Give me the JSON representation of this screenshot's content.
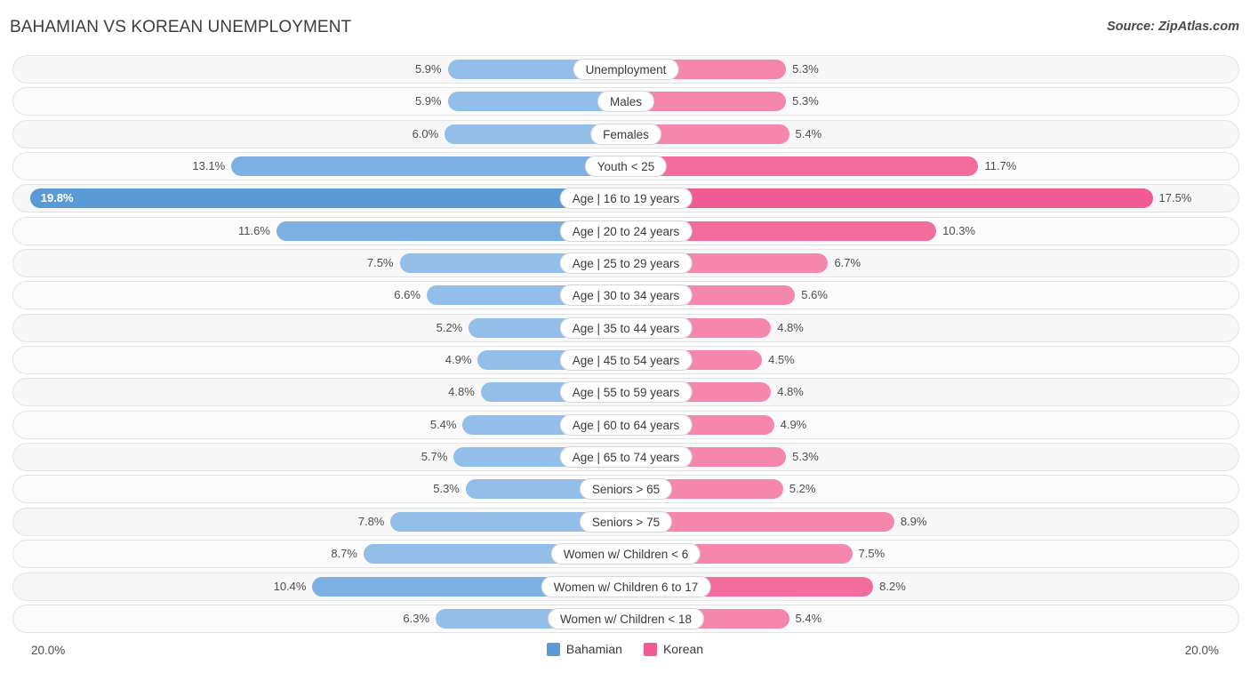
{
  "header": {
    "title": "BAHAMIAN VS KOREAN UNEMPLOYMENT",
    "source": "Source: ZipAtlas.com"
  },
  "axis": {
    "left_max_label": "20.0%",
    "right_max_label": "20.0%"
  },
  "legend": {
    "items": [
      {
        "label": "Bahamian",
        "color": "#5b9bd5"
      },
      {
        "label": "Korean",
        "color": "#ef5b92"
      }
    ]
  },
  "chart_data": {
    "type": "bar",
    "title": "BAHAMIAN VS KOREAN UNEMPLOYMENT",
    "orientation": "horizontal-diverging",
    "xlabel": "",
    "ylabel": "",
    "xlim": [
      0,
      20
    ],
    "axis_max": 20.0,
    "grid": false,
    "legend_position": "bottom-center",
    "categories": [
      "Unemployment",
      "Males",
      "Females",
      "Youth < 25",
      "Age | 16 to 19 years",
      "Age | 20 to 24 years",
      "Age | 25 to 29 years",
      "Age | 30 to 34 years",
      "Age | 35 to 44 years",
      "Age | 45 to 54 years",
      "Age | 55 to 59 years",
      "Age | 60 to 64 years",
      "Age | 65 to 74 years",
      "Seniors > 65",
      "Seniors > 75",
      "Women w/ Children < 6",
      "Women w/ Children 6 to 17",
      "Women w/ Children < 18"
    ],
    "series": [
      {
        "name": "Bahamian",
        "color": "#5b9bd5",
        "values": [
          5.9,
          5.9,
          6.0,
          13.1,
          19.8,
          11.6,
          7.5,
          6.6,
          5.2,
          4.9,
          4.8,
          5.4,
          5.7,
          5.3,
          7.8,
          8.7,
          10.4,
          6.3
        ],
        "labels": [
          "5.9%",
          "5.9%",
          "6.0%",
          "13.1%",
          "19.8%",
          "11.6%",
          "7.5%",
          "6.6%",
          "5.2%",
          "4.9%",
          "4.8%",
          "5.4%",
          "5.7%",
          "5.3%",
          "7.8%",
          "8.7%",
          "10.4%",
          "6.3%"
        ]
      },
      {
        "name": "Korean",
        "color": "#ef5b92",
        "values": [
          5.3,
          5.3,
          5.4,
          11.7,
          17.5,
          10.3,
          6.7,
          5.6,
          4.8,
          4.5,
          4.8,
          4.9,
          5.3,
          5.2,
          8.9,
          7.5,
          8.2,
          5.4
        ],
        "labels": [
          "5.3%",
          "5.3%",
          "5.4%",
          "11.7%",
          "17.5%",
          "10.3%",
          "6.7%",
          "5.6%",
          "4.8%",
          "4.5%",
          "4.8%",
          "4.9%",
          "5.3%",
          "5.2%",
          "8.9%",
          "7.5%",
          "8.2%",
          "5.4%"
        ]
      }
    ]
  }
}
